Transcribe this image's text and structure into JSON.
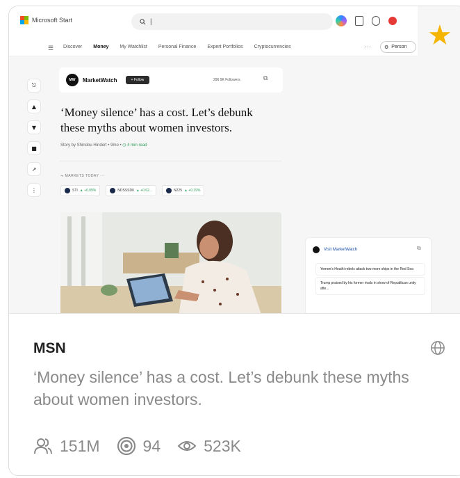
{
  "preview": {
    "topbar": {
      "logo_text": "Microsoft Start",
      "search_text": "|"
    },
    "nav": {
      "items": [
        "Discover",
        "Money",
        "My Watchlist",
        "Personal Finance",
        "Expert Portfolios",
        "Cryptocurrencies"
      ],
      "active": "Money",
      "more": "···",
      "personalize_label": "Person"
    },
    "publisher": {
      "name": "MarketWatch",
      "logo_text": "MW",
      "follow_label": "+ Follow",
      "followers": "296.9K Followers"
    },
    "headline": "‘Money silence’ has a cost. Let’s debunk these myths about women investors.",
    "byline_prefix": "Story by Shinobu Hindert • 9mo •",
    "read_time": "4 min read",
    "markets_label": "MARKETS TODAY",
    "tickers": [
      {
        "name": "STI",
        "change": "▲ +0.09%"
      },
      {
        "name": "NDSSSD0",
        "change": "▲ +0.62..."
      },
      {
        "name": "N225",
        "change": "▲ +0.19%"
      }
    ],
    "side": {
      "link_label": "Visit MarketWatch",
      "items": [
        "Yemen's Houthi rebels attack two more ships in the Red Sea",
        "Trump praised by his former rivals in show of Republican unity afte..."
      ]
    }
  },
  "card": {
    "source": "MSN",
    "description": "‘Money silence’ has a cost. Let’s debunk these myths about women investors.",
    "stats": {
      "users": "151M",
      "target": "94",
      "views": "523K"
    }
  },
  "colors": {
    "star": "#f5b400",
    "muted_text": "#8a8a8a",
    "source_text": "#222222"
  },
  "icons": [
    "star-icon",
    "globe-icon",
    "users-icon",
    "target-icon",
    "eye-icon",
    "search-icon",
    "copilot-icon"
  ]
}
